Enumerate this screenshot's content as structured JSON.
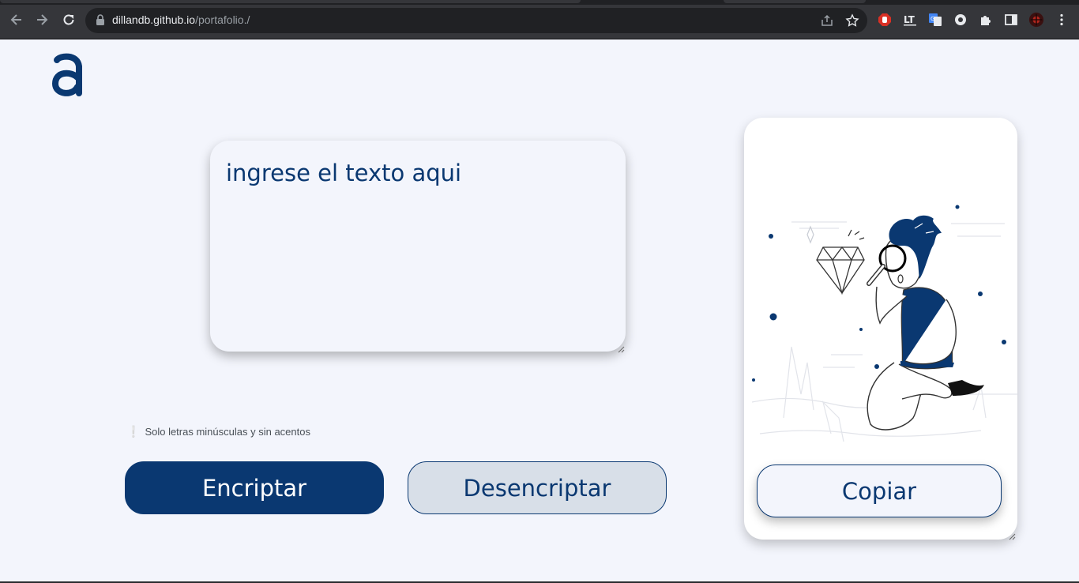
{
  "browser": {
    "url_host": "dillandb.github.io",
    "url_path": "/portafolio./"
  },
  "icons": {
    "back": "arrow-left-icon",
    "forward": "arrow-right-icon",
    "reload": "reload-icon",
    "lock": "lock-icon",
    "share": "share-icon",
    "bookmark": "star-icon",
    "extensions": [
      "stop-hand-icon",
      "translate-text-icon",
      "google-translate-icon",
      "record-icon",
      "puzzle-icon",
      "side-panel-icon",
      "profile-avatar-icon",
      "kebab-menu-icon"
    ],
    "hint": "exclamation-icon",
    "logo": "alura-logo-icon"
  },
  "main": {
    "input_placeholder": "ingrese el texto aqui",
    "hint_text": "Solo letras minúsculas y sin acentos",
    "encrypt_label": "Encriptar",
    "decrypt_label": "Desencriptar"
  },
  "output": {
    "illustration": "person-with-magnifying-glass-and-diamond-illustration",
    "copy_label": "Copiar"
  },
  "colors": {
    "primary": "#0a3871",
    "background": "#f3f5fc",
    "secondary_button": "#d8dfe8"
  }
}
